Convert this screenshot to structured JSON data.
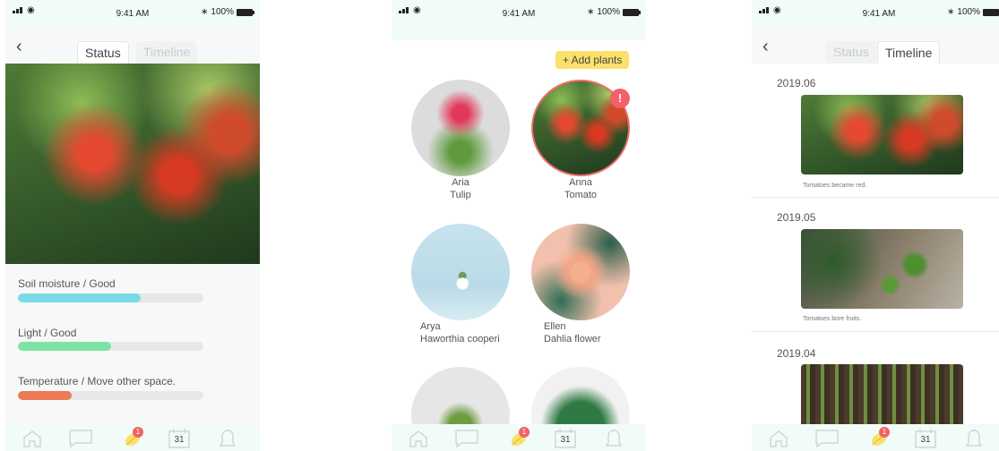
{
  "status_bar": {
    "time": "9:41 AM",
    "battery": "100%"
  },
  "screen1": {
    "tabs": [
      {
        "label": "Status",
        "active": true
      },
      {
        "label": "Timeline",
        "active": false
      }
    ],
    "stats": [
      {
        "label": "Soil moisture / Good",
        "level": 0.66,
        "color": "#7ad9e6"
      },
      {
        "label": "Light / Good",
        "level": 0.5,
        "color": "#7de3a3"
      },
      {
        "label": "Temperature / Move other space.",
        "level": 0.29,
        "color": "#ec7b55"
      }
    ]
  },
  "screen2": {
    "add_button": "+ Add plants",
    "plants": [
      {
        "name": "Aria",
        "species": "Tulip",
        "alert": false
      },
      {
        "name": "Anna",
        "species": "Tomato",
        "alert": true,
        "alert_mark": "!"
      },
      {
        "name": "Arya",
        "species": "Haworthia cooperi",
        "alert": false
      },
      {
        "name": "Ellen",
        "species": "Dahlia flower",
        "alert": false
      }
    ]
  },
  "screen3": {
    "tabs": [
      {
        "label": "Status",
        "active": false
      },
      {
        "label": "Timeline",
        "active": true
      }
    ],
    "entries": [
      {
        "date": "2019.06",
        "caption": "Tomatoes became red."
      },
      {
        "date": "2019.05",
        "caption": "Tomatoes bore fruits."
      },
      {
        "date": "2019.04",
        "caption": ""
      }
    ]
  },
  "tab_bar": {
    "items": [
      {
        "icon": "home-icon"
      },
      {
        "icon": "chat-icon"
      },
      {
        "icon": "leaf-icon",
        "badge": "1"
      },
      {
        "icon": "calendar-icon",
        "label": "31"
      },
      {
        "icon": "bell-icon"
      }
    ]
  },
  "colors": {
    "status_bg": "#f1fbf8",
    "accent_yellow": "#fbe16a",
    "alert_red": "#f36068"
  }
}
